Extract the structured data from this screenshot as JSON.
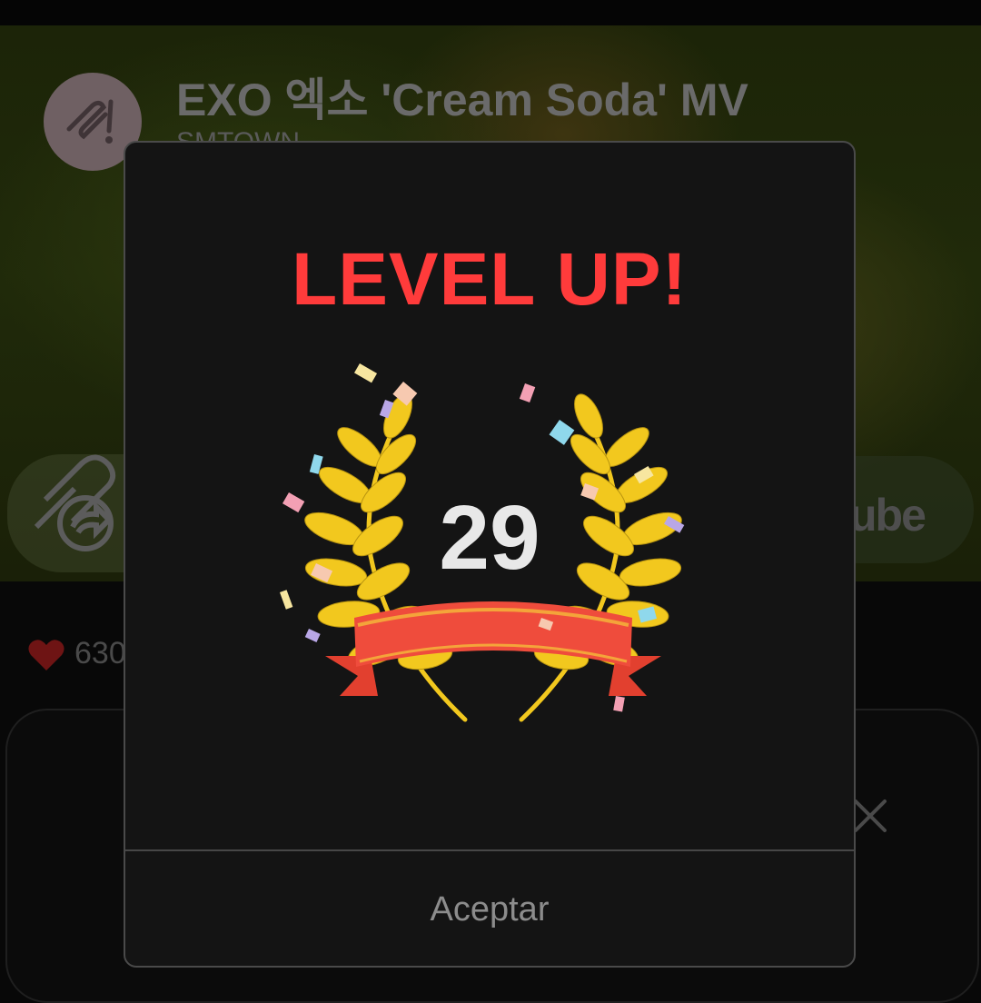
{
  "video": {
    "title": "EXO 엑소 'Cream Soda' MV",
    "channel": "SMTOWN",
    "youtube_label": "ube",
    "likes": "630"
  },
  "dialog": {
    "title": "LEVEL UP!",
    "level": "29",
    "accept_label": "Aceptar"
  },
  "colors": {
    "title_red": "#ff3b3b",
    "laurel_gold": "#f2c81e",
    "ribbon_red": "#ef4c3c"
  },
  "icons": [
    "sm-logo-icon",
    "share-icon",
    "heart-icon",
    "close-icon",
    "laurel-wreath-icon",
    "confetti-icon"
  ]
}
